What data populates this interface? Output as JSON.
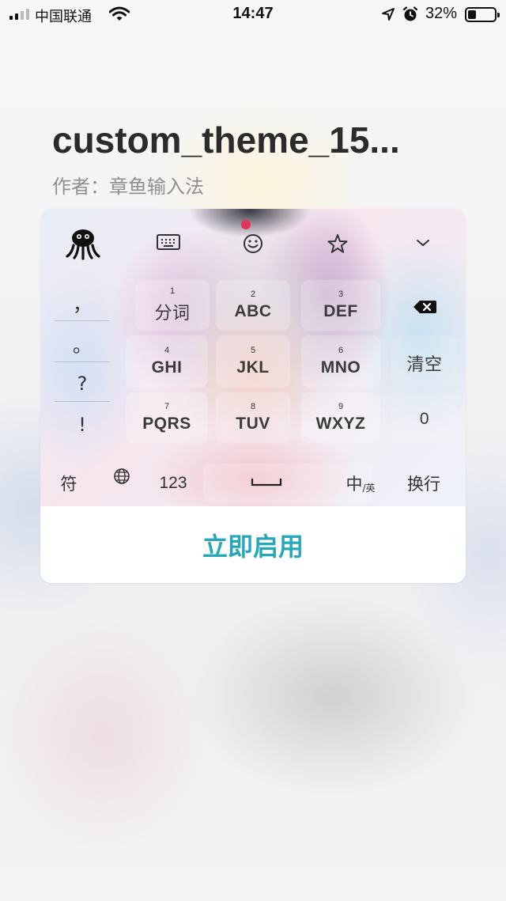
{
  "status_bar": {
    "carrier": "中国联通",
    "time": "14:47",
    "battery_percent": "32%",
    "battery_level": 0.32,
    "signal_bars": 2,
    "icons": [
      "signal-icon",
      "wifi-icon",
      "location-arrow-icon",
      "alarm-icon",
      "battery-icon"
    ]
  },
  "theme": {
    "title": "custom_theme_15...",
    "author": "作者：章鱼输入法"
  },
  "keyboard_preview": {
    "toolbar_icons": [
      "octopus-logo-icon",
      "keyboard-icon",
      "emoji-icon",
      "star-icon",
      "chevron-down-icon"
    ],
    "side_keys": [
      "，",
      "。",
      "?",
      "!"
    ],
    "keys": [
      {
        "num": "1",
        "label": "分词"
      },
      {
        "num": "2",
        "label": "ABC"
      },
      {
        "num": "3",
        "label": "DEF"
      },
      {
        "num": "4",
        "label": "GHI"
      },
      {
        "num": "5",
        "label": "JKL"
      },
      {
        "num": "6",
        "label": "MNO"
      },
      {
        "num": "7",
        "label": "PQRS"
      },
      {
        "num": "8",
        "label": "TUV"
      },
      {
        "num": "9",
        "label": "WXYZ"
      }
    ],
    "right_keys": {
      "clear": "清空",
      "zero": "0"
    },
    "bottom_keys": {
      "symbols": "符",
      "num": "123",
      "lang_main": "中",
      "lang_sub": "/英",
      "enter": "换行"
    }
  },
  "action": {
    "enable_label": "立即启用"
  },
  "colors": {
    "accent": "#27a8b8",
    "title": "#2b2b2b",
    "author": "#8e8e93"
  }
}
